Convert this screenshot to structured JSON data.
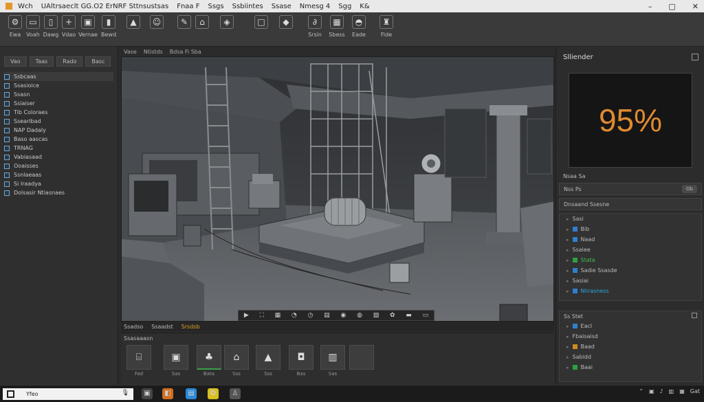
{
  "titlebar": {
    "menu": [
      "Wch",
      "UAltrsaeclt GG.O2 ErNRF Sttnsustsas",
      "Fnaa F",
      "Ssgs",
      "Ssbiintes",
      "Ssase",
      "Nmesg 4",
      "Sgg",
      "K&"
    ],
    "minimize": "–",
    "maximize": "▢",
    "close": "✕"
  },
  "toolbar": {
    "tools": [
      {
        "icon": "gear-icon",
        "glyph": "⚙",
        "label": "Ewa"
      },
      {
        "icon": "file-icon",
        "glyph": "▭",
        "label": "Voah"
      },
      {
        "icon": "phone-icon",
        "glyph": "▯",
        "label": "Dawg"
      },
      {
        "icon": "move-icon",
        "glyph": "+",
        "label": "Vdao"
      },
      {
        "icon": "device-icon",
        "glyph": "▣",
        "label": "Vernae"
      },
      {
        "icon": "tablet-icon",
        "glyph": "▮",
        "label": "Bewd"
      },
      {
        "icon": "landscape-icon",
        "glyph": "▲",
        "label": ""
      },
      {
        "icon": "face-icon",
        "glyph": "☺",
        "label": ""
      },
      {
        "icon": "pen-icon",
        "glyph": "✎",
        "label": ""
      },
      {
        "icon": "brush-icon",
        "glyph": "⌂",
        "label": ""
      },
      {
        "icon": "render-icon",
        "glyph": "◈",
        "label": ""
      },
      {
        "icon": "frame-icon",
        "glyph": "□",
        "label": ""
      },
      {
        "icon": "diamond-icon",
        "glyph": "◆",
        "label": ""
      },
      {
        "icon": "curve-icon",
        "glyph": "∂",
        "label": "Srsin"
      },
      {
        "icon": "camera-icon",
        "glyph": "▦",
        "label": "Sbess"
      },
      {
        "icon": "light-icon",
        "glyph": "◓",
        "label": "Eade"
      },
      {
        "icon": "paint-icon",
        "glyph": "♜",
        "label": "Fide"
      }
    ]
  },
  "left_panel": {
    "tabs": [
      "Vao",
      "Taas",
      "Rado",
      "Basc"
    ],
    "items": [
      "Ssbcaas",
      "Ssasioice",
      "Ssasn",
      "Ssiaiser",
      "Tib Coloraes",
      "Ssearlbad",
      "NAP Dadaly",
      "Baso aascas",
      "TRNAG",
      "Vabiasaad",
      "Ooaisses",
      "Ssnlaeaas",
      "Si lraadya",
      "Dolsasir Ntiasnaes"
    ]
  },
  "viewport": {
    "header": [
      "Vase",
      "Ntistds",
      "Bdsa Fi Sba"
    ],
    "bottom_tools": [
      "▶",
      "⛶",
      "▦",
      "◔",
      "◷",
      "▤",
      "◉",
      "◍",
      "▨",
      "✿",
      "▬",
      "▭"
    ],
    "footer": [
      {
        "label": "Ssadso",
        "active": false
      },
      {
        "label": "Ssaadst",
        "active": false
      },
      {
        "label": "Srsdsb",
        "active": true
      }
    ]
  },
  "assets": {
    "title": "Ssasaaasn",
    "items": [
      {
        "icon": "brackets-icon",
        "glyph": "⌸",
        "caption": "Fad",
        "selected": false
      },
      {
        "icon": "box-icon",
        "glyph": "▣",
        "caption": "Sas",
        "selected": false
      },
      {
        "icon": "tree-icon",
        "glyph": "♣",
        "caption": "Bata",
        "selected": true
      },
      {
        "icon": "house-icon",
        "glyph": "⌂",
        "caption": "Sss",
        "selected": false
      },
      {
        "icon": "cone-icon",
        "glyph": "▲",
        "caption": "Sss",
        "selected": false
      },
      {
        "icon": "cube-icon",
        "glyph": "◘",
        "caption": "Bas",
        "selected": false
      },
      {
        "icon": "panel-icon",
        "glyph": "▥",
        "caption": "Sas",
        "selected": false
      },
      {
        "icon": "empty-icon",
        "glyph": "",
        "caption": "",
        "selected": false
      }
    ]
  },
  "right_panel": {
    "title": "Slliender",
    "render_progress_text": "95%",
    "render_progress": 0.95,
    "info_line1": "Nsaa Sa",
    "info_line2": "Nss Ps",
    "info_btn": "Ob",
    "section1_title": "Dnsaand Ssesne",
    "section1_items": [
      {
        "label": "Sasi",
        "icon": "none"
      },
      {
        "label": "Bib",
        "icon": "blue"
      },
      {
        "label": "Naad",
        "icon": "blue"
      },
      {
        "label": "Ssalee",
        "icon": "none"
      },
      {
        "label": "Stata",
        "icon": "green",
        "style": "green"
      },
      {
        "label": "Sadie Ssasde",
        "icon": "blue"
      },
      {
        "label": "Sasiai",
        "icon": "none"
      },
      {
        "label": "Niirasness",
        "icon": "blue",
        "style": "hl"
      }
    ],
    "section2_title": "Ss Stet",
    "section2_items": [
      {
        "label": "Eacl",
        "icon": "blue"
      },
      {
        "label": "Fbaisaisd",
        "icon": "none"
      },
      {
        "label": "Baad",
        "icon": "orange"
      },
      {
        "label": "Sabidd",
        "icon": "none"
      },
      {
        "label": "Baai",
        "icon": "green"
      }
    ]
  },
  "taskbar": {
    "search_placeholder": "Yfeo",
    "mic": "🎙",
    "apps": [
      "▣",
      "◧",
      "▤",
      "❂",
      "♙"
    ],
    "tray": [
      "⌃",
      "▣",
      "♪",
      "▥",
      "▦",
      "Gat"
    ]
  },
  "colors": {
    "accent_orange": "#e08a30",
    "accent_green": "#3aa04a",
    "accent_blue": "#2aa8e0"
  }
}
